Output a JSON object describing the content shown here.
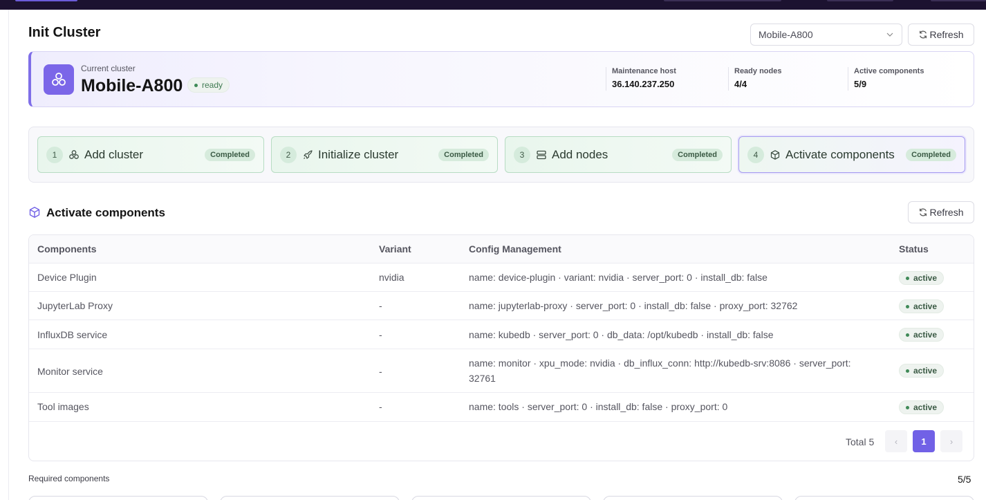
{
  "page": {
    "title": "Init Cluster"
  },
  "header": {
    "cluster_select_value": "Mobile-A800",
    "refresh_label": "Refresh"
  },
  "cluster": {
    "label": "Current cluster",
    "name": "Mobile-A800",
    "status": "ready",
    "stats": [
      {
        "label": "Maintenance host",
        "value": "36.140.237.250"
      },
      {
        "label": "Ready nodes",
        "value": "4/4"
      },
      {
        "label": "Active components",
        "value": "5/9"
      }
    ]
  },
  "steps": [
    {
      "num": "1",
      "title": "Add cluster",
      "status": "Completed",
      "icon": "cluster-icon"
    },
    {
      "num": "2",
      "title": "Initialize cluster",
      "status": "Completed",
      "icon": "rocket-icon"
    },
    {
      "num": "3",
      "title": "Add nodes",
      "status": "Completed",
      "icon": "server-icon"
    },
    {
      "num": "4",
      "title": "Activate components",
      "status": "Completed",
      "icon": "package-icon"
    }
  ],
  "section": {
    "title": "Activate components",
    "refresh_label": "Refresh"
  },
  "table": {
    "columns": [
      "Components",
      "Variant",
      "Config Management",
      "Status"
    ],
    "rows": [
      {
        "component": "Device Plugin",
        "variant": "nvidia",
        "config": "name: device-plugin · variant: nvidia · server_port: 0 · install_db: false",
        "status": "active"
      },
      {
        "component": "JupyterLab Proxy",
        "variant": "-",
        "config": "name: jupyterlab-proxy · server_port: 0 · install_db: false · proxy_port: 32762",
        "status": "active"
      },
      {
        "component": "InfluxDB service",
        "variant": "-",
        "config": "name: kubedb · server_port: 0 · db_data: /opt/kubedb · install_db: false",
        "status": "active"
      },
      {
        "component": "Monitor service",
        "variant": "-",
        "config": "name: monitor · xpu_mode: nvidia · db_influx_conn: http://kubedb-srv:8086 · server_port: 32761",
        "status": "active"
      },
      {
        "component": "Tool images",
        "variant": "-",
        "config": "name: tools · server_port: 0 · install_db: false · proxy_port: 0",
        "status": "active"
      }
    ]
  },
  "pagination": {
    "total_label": "Total 5",
    "current_page": "1",
    "prev": "‹",
    "next": "›"
  },
  "required": {
    "label": "Required components",
    "count": "5/5"
  },
  "colors": {
    "accent": "#7161e6",
    "success_bg": "#e9f6ed",
    "success_text": "#3a5a44"
  }
}
